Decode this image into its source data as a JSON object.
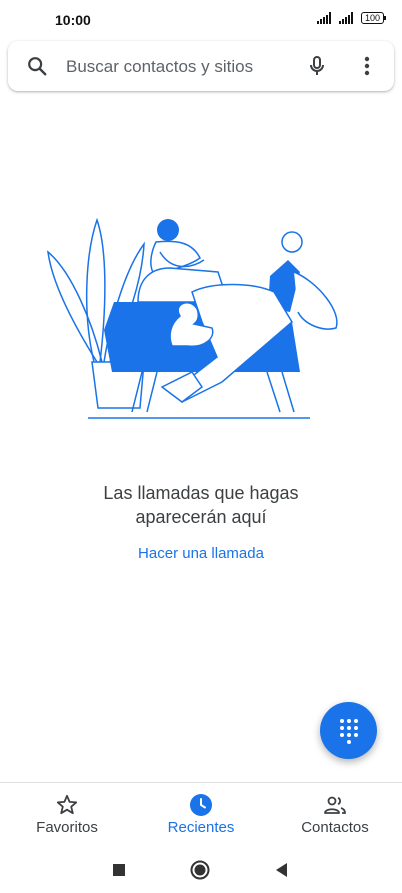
{
  "status_bar": {
    "time": "10:00",
    "battery": "100"
  },
  "search": {
    "placeholder": "Buscar contactos y sitios",
    "icons": [
      "search-icon",
      "mic-icon",
      "more-vert-icon"
    ]
  },
  "empty_state": {
    "message_line1": "Las llamadas que hagas",
    "message_line2": "aparecerán aquí",
    "action_label": "Hacer una llamada"
  },
  "fab": {
    "icon": "dialpad-icon"
  },
  "bottom_nav": {
    "items": [
      {
        "label": "Favoritos",
        "icon": "star-icon",
        "active": false
      },
      {
        "label": "Recientes",
        "icon": "clock-icon",
        "active": true
      },
      {
        "label": "Contactos",
        "icon": "people-icon",
        "active": false
      }
    ]
  },
  "colors": {
    "accent": "#1a73e8",
    "text_primary": "#202124",
    "text_secondary": "#5f6368"
  }
}
